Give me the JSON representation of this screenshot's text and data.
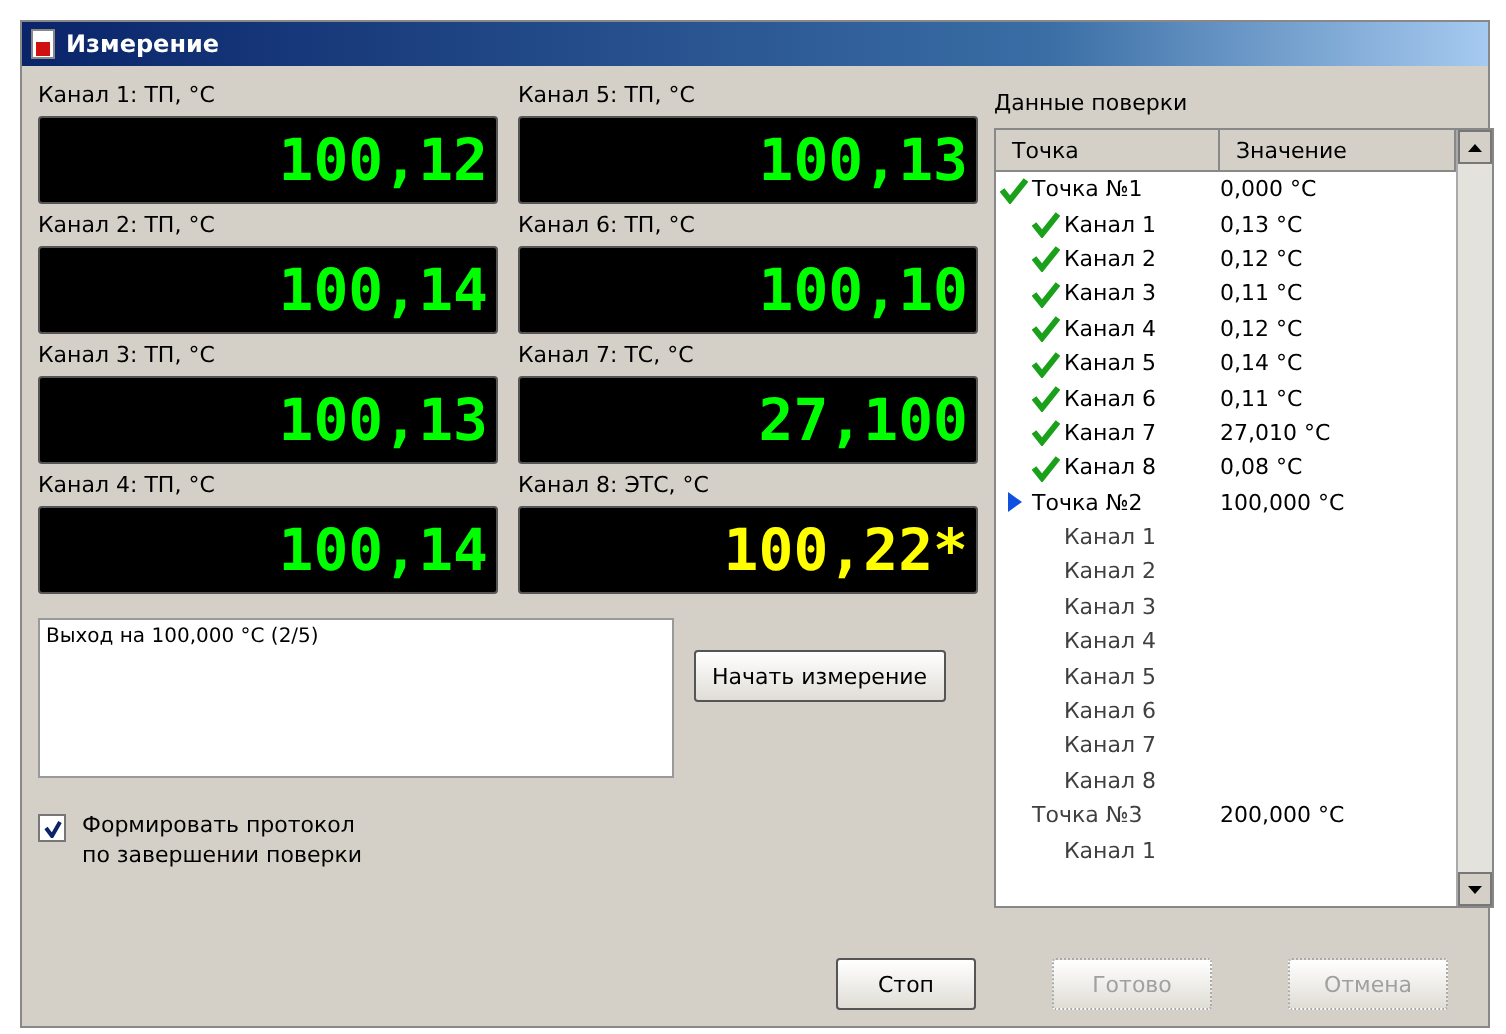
{
  "window": {
    "title": "Измерение"
  },
  "meters": [
    {
      "label": "Канал 1: ТП, °С",
      "value": "100,12",
      "color": "#00ff00"
    },
    {
      "label": "Канал 5: ТП, °С",
      "value": "100,13",
      "color": "#00ff00"
    },
    {
      "label": "Канал 2: ТП, °С",
      "value": "100,14",
      "color": "#00ff00"
    },
    {
      "label": "Канал 6: ТП, °С",
      "value": "100,10",
      "color": "#00ff00"
    },
    {
      "label": "Канал 3: ТП, °С",
      "value": "100,13",
      "color": "#00ff00"
    },
    {
      "label": "Канал 7: ТС, °С",
      "value": "27,100",
      "color": "#00ff00"
    },
    {
      "label": "Канал 4: ТП, °С",
      "value": "100,14",
      "color": "#00ff00"
    },
    {
      "label": "Канал 8: ЭТС, °С",
      "value": "100,22*",
      "color": "#ffff00"
    }
  ],
  "log": {
    "value": "Выход на 100,000 °С (2/5)"
  },
  "start_button": "Начать измерение",
  "protocol_checkbox": {
    "label": "Формировать протокол\nпо завершении поверки",
    "checked": true
  },
  "verification": {
    "title": "Данные поверки",
    "columns": [
      "Точка",
      "Значение"
    ],
    "rows": [
      {
        "name": "Точка №1",
        "value": "0,000 °С",
        "kind": "done",
        "children": [
          {
            "name": "Канал 1",
            "value": "0,13 °С",
            "kind": "done"
          },
          {
            "name": "Канал 2",
            "value": "0,12 °С",
            "kind": "done"
          },
          {
            "name": "Канал 3",
            "value": "0,11 °С",
            "kind": "done"
          },
          {
            "name": "Канал 4",
            "value": "0,12 °С",
            "kind": "done"
          },
          {
            "name": "Канал 5",
            "value": "0,14 °С",
            "kind": "done"
          },
          {
            "name": "Канал 6",
            "value": "0,11 °С",
            "kind": "done"
          },
          {
            "name": "Канал 7",
            "value": "27,010 °С",
            "kind": "done"
          },
          {
            "name": "Канал 8",
            "value": "0,08 °С",
            "kind": "done"
          }
        ]
      },
      {
        "name": "Точка №2",
        "value": "100,000 °С",
        "kind": "current",
        "children": [
          {
            "name": "Канал 1",
            "kind": "pending"
          },
          {
            "name": "Канал 2",
            "kind": "pending"
          },
          {
            "name": "Канал 3",
            "kind": "pending"
          },
          {
            "name": "Канал 4",
            "kind": "pending"
          },
          {
            "name": "Канал 5",
            "kind": "pending"
          },
          {
            "name": "Канал 6",
            "kind": "pending"
          },
          {
            "name": "Канал 7",
            "kind": "pending"
          },
          {
            "name": "Канал 8",
            "kind": "pending"
          }
        ]
      },
      {
        "name": "Точка №3",
        "value": "200,000 °С",
        "kind": "pending",
        "children": [
          {
            "name": "Канал 1",
            "kind": "pending"
          }
        ]
      }
    ]
  },
  "buttons": [
    {
      "label": "Стоп",
      "disabled": false
    },
    {
      "label": "Готово",
      "disabled": true
    },
    {
      "label": "Отмена",
      "disabled": true
    }
  ]
}
